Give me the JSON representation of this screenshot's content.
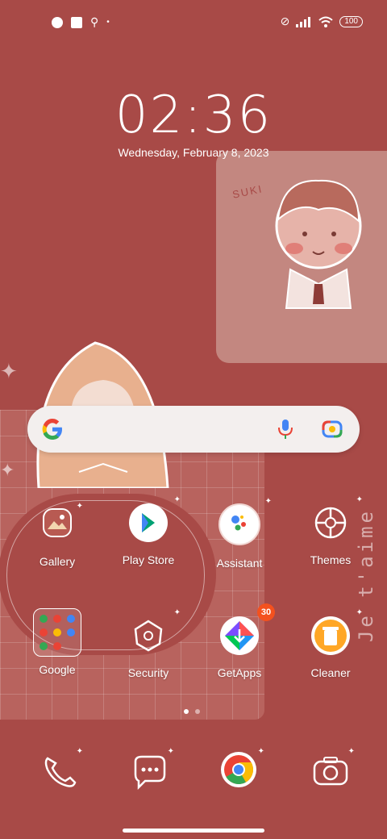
{
  "status_bar": {
    "left_icons": [
      "notification-icon",
      "square-notification-icon",
      "location-icon",
      "dot-icon"
    ],
    "right_icons": [
      "vibrate-off-icon",
      "signal-icon",
      "wifi-icon"
    ],
    "battery": "100"
  },
  "clock": {
    "time": "02:36",
    "date": "Wednesday, February 8, 2023"
  },
  "wallpaper": {
    "text_suki": "SUKI",
    "text_jetaime": "Je t'aime"
  },
  "search": {
    "mic": "mic-icon",
    "lens": "lens-icon"
  },
  "apps": [
    {
      "label": "Gallery",
      "icon": "gallery-icon"
    },
    {
      "label": "Play Store",
      "icon": "play-store-icon"
    },
    {
      "label": "Assistant",
      "icon": "assistant-icon"
    },
    {
      "label": "Themes",
      "icon": "themes-icon"
    },
    {
      "label": "Google",
      "icon": "google-folder-icon"
    },
    {
      "label": "Security",
      "icon": "security-icon"
    },
    {
      "label": "GetApps",
      "icon": "getapps-icon",
      "badge": "30"
    },
    {
      "label": "Cleaner",
      "icon": "cleaner-icon"
    }
  ],
  "dock": [
    {
      "icon": "phone-icon"
    },
    {
      "icon": "messages-icon"
    },
    {
      "icon": "chrome-icon"
    },
    {
      "icon": "camera-icon"
    }
  ],
  "page_indicator": {
    "pages": 2,
    "active": 1
  },
  "colors": {
    "background": "#a84a47",
    "accent": "#f4511e"
  }
}
